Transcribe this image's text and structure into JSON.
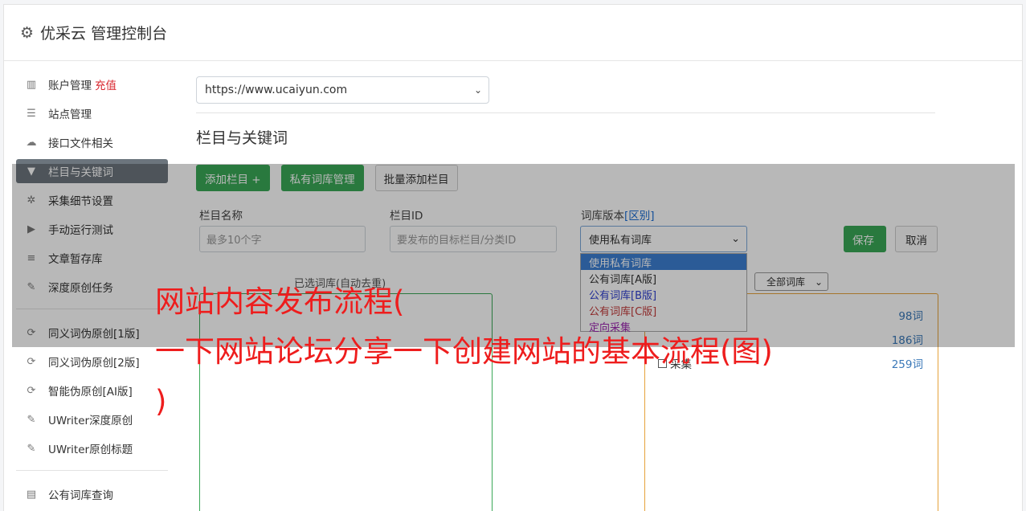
{
  "header": {
    "icon": "gear-icon",
    "title": "优采云 管理控制台"
  },
  "sidebar": {
    "items": [
      {
        "label": "账户管理",
        "icon": "bar-chart-icon",
        "extra": "充值"
      },
      {
        "label": "站点管理",
        "icon": "server-icon"
      },
      {
        "label": "接口文件相关",
        "icon": "cloud-upload-icon"
      },
      {
        "label": "栏目与关键词",
        "icon": "filter-icon",
        "active": true
      },
      {
        "label": "采集细节设置",
        "icon": "gears-icon"
      },
      {
        "label": "手动运行测试",
        "icon": "play-circle-icon"
      },
      {
        "label": "文章暂存库",
        "icon": "database-icon"
      },
      {
        "label": "深度原创任务",
        "icon": "edit-icon"
      }
    ],
    "items2": [
      {
        "label": "同义词伪原创[1版]",
        "icon": "refresh-icon"
      },
      {
        "label": "同义词伪原创[2版]",
        "icon": "refresh-icon"
      },
      {
        "label": "智能伪原创[AI版]",
        "icon": "refresh-icon"
      },
      {
        "label": "UWriter深度原创",
        "icon": "edit-icon"
      },
      {
        "label": "UWriter原创标题",
        "icon": "edit-icon"
      }
    ],
    "items3": [
      {
        "label": "公有词库查询",
        "icon": "book-icon"
      }
    ]
  },
  "main": {
    "site_select": "https://www.ucaiyun.com",
    "section_title": "栏目与关键词",
    "buttons": {
      "add_column": "添加栏目 +",
      "private_lib": "私有词库管理",
      "batch_add": "批量添加栏目"
    },
    "fields": {
      "column_name_label": "栏目名称",
      "column_name_placeholder": "最多10个字",
      "column_id_label": "栏目ID",
      "column_id_placeholder": "要发布的目标栏目/分类ID",
      "lib_version_label": "词库版本",
      "lib_version_link": "[区别]",
      "lib_version_value": "使用私有词库"
    },
    "save": "保存",
    "cancel": "取消",
    "dropdown_options": [
      "使用私有词库",
      "公有词库[A版]",
      "公有词库[B版]",
      "公有词库[C版]",
      "定向采集"
    ],
    "left_box_label": "已选词库(自动去重)",
    "filter_select": "全部词库",
    "libs": [
      {
        "name": "",
        "count": "98词"
      },
      {
        "name": "",
        "count": "186词"
      },
      {
        "name": "采集",
        "count": "259词"
      }
    ]
  },
  "overlay_text": {
    "line1": "网站内容发布流程(",
    "line2": "一下网站论坛分享一下创建网站的基本流程(图)",
    "line3": ")"
  },
  "colors": {
    "accent_green": "#3aa857",
    "active_gray": "#6c757d",
    "overlay_red": "#ee1d1d",
    "link_blue": "#1c6ed5"
  }
}
